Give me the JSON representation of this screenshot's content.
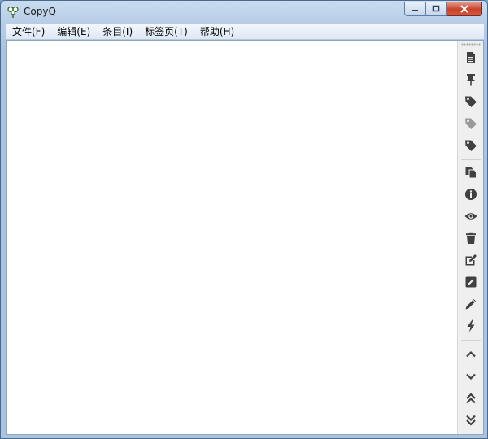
{
  "window": {
    "title": "CopyQ"
  },
  "menu": [
    {
      "label": "文件(F)"
    },
    {
      "label": "编辑(E)"
    },
    {
      "label": "条目(I)"
    },
    {
      "label": "标签页(T)"
    },
    {
      "label": "帮助(H)"
    }
  ],
  "toolbar": {
    "groups": [
      [
        "file-icon",
        "pin-icon",
        "tag-icon",
        "tag-outline-icon",
        "tag-icon"
      ],
      [
        "copy-icon",
        "info-icon",
        "eye-icon",
        "trash-icon",
        "edit-external-icon",
        "edit-icon",
        "pencil-icon",
        "bolt-icon"
      ],
      [
        "chevron-up-icon",
        "chevron-down-icon",
        "double-chevron-up-icon",
        "double-chevron-down-icon"
      ]
    ]
  },
  "colors": {
    "icon": "#404040",
    "icon_disabled": "#9a9a9a",
    "titlebar": "#b7cde6",
    "close_button": "#c7412b"
  }
}
